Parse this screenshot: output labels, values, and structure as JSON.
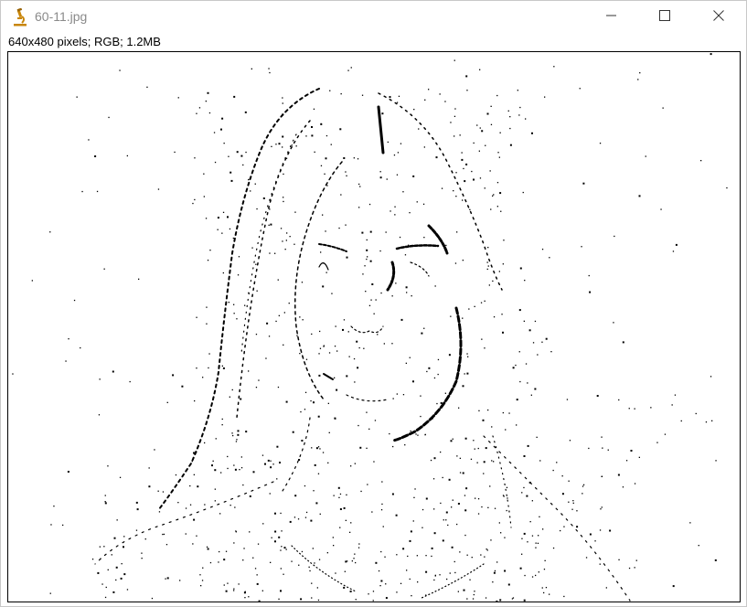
{
  "window": {
    "title": "60-11.jpg",
    "info": "640x480 pixels; RGB; 1.2MB"
  },
  "icons": {
    "app": "microscope-icon",
    "minimize": "minimize-icon",
    "maximize": "maximize-icon",
    "close": "close-icon"
  },
  "image": {
    "description_kind": "edge-detected-portrait",
    "colors": {
      "foreground": "#000000",
      "background": "#ffffff"
    }
  }
}
